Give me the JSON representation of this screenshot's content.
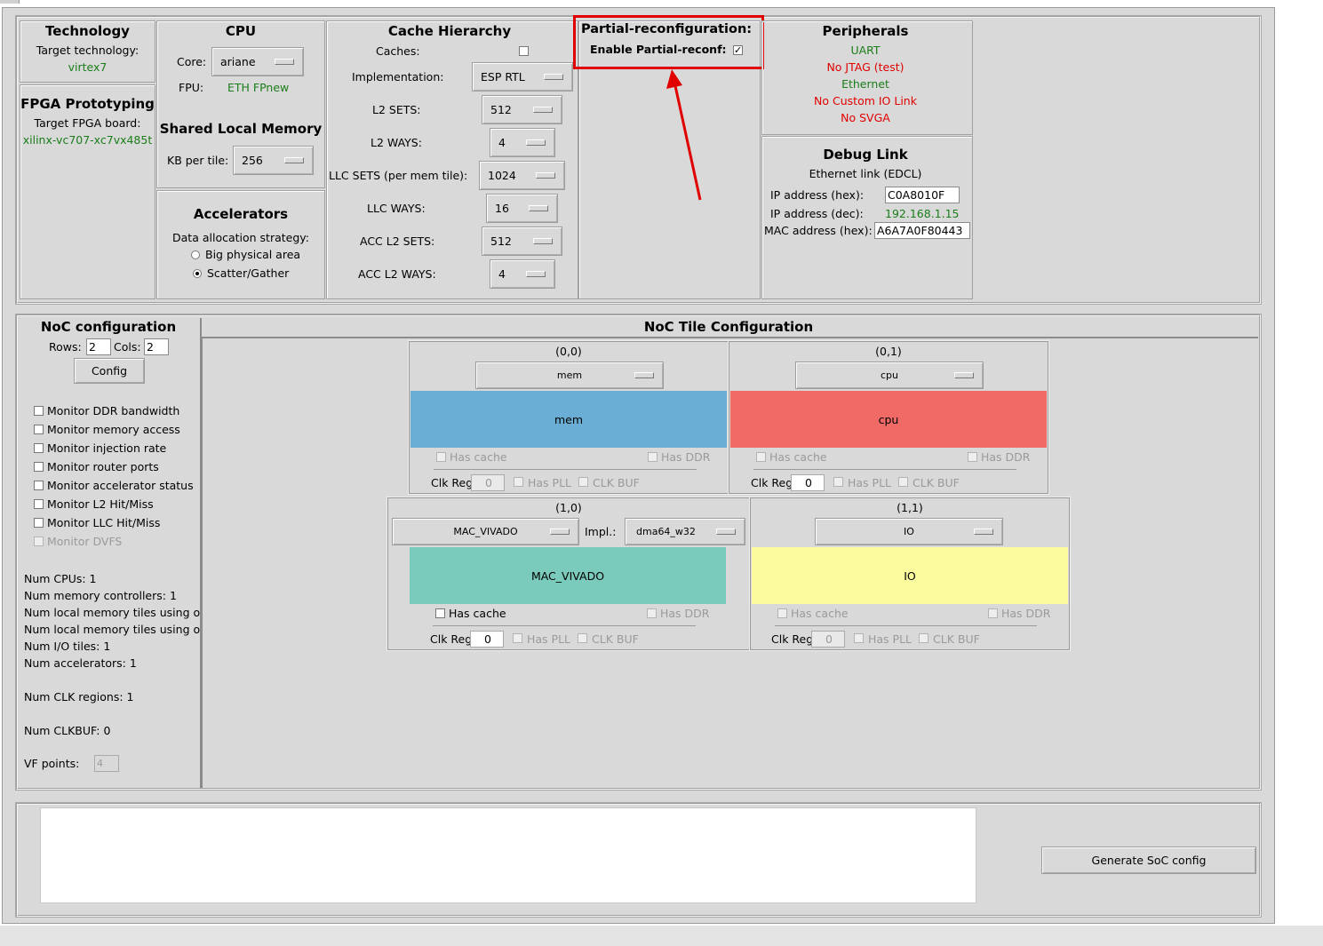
{
  "technology": {
    "title": "Technology",
    "target_label": "Target technology:",
    "target_value": "virtex7"
  },
  "fpga": {
    "title": "FPGA Prototyping",
    "board_label": "Target FPGA board:",
    "board_value": "xilinx-vc707-xc7vx485t"
  },
  "cpu": {
    "title": "CPU",
    "core_label": "Core:",
    "core_value": "ariane",
    "fpu_label": "FPU:",
    "fpu_value": "ETH FPnew"
  },
  "shared_mem": {
    "title": "Shared Local Memory",
    "kb_label": "KB per tile:",
    "kb_value": "256"
  },
  "accelerators": {
    "title": "Accelerators",
    "strategy_label": "Data allocation strategy:",
    "opt1": "Big physical area",
    "opt2": "Scatter/Gather",
    "selected": "Scatter/Gather"
  },
  "cache": {
    "title": "Cache Hierarchy",
    "caches_label": "Caches:",
    "caches_checked": false,
    "impl_label": "Implementation:",
    "impl_value": "ESP RTL",
    "l2_sets_label": "L2 SETS:",
    "l2_sets": "512",
    "l2_ways_label": "L2 WAYS:",
    "l2_ways": "4",
    "llc_sets_label": "LLC SETS (per mem tile):",
    "llc_sets": "1024",
    "llc_ways_label": "LLC WAYS:",
    "llc_ways": "16",
    "acc_l2_sets_label": "ACC L2 SETS:",
    "acc_l2_sets": "512",
    "acc_l2_ways_label": "ACC L2 WAYS:",
    "acc_l2_ways": "4"
  },
  "pr": {
    "title": "Partial-reconfiguration:",
    "enable_label": "Enable Partial-reconf:",
    "enabled": true,
    "check_glyph": "✓"
  },
  "peripherals": {
    "title": "Peripherals",
    "uart": "UART",
    "jtag": "No JTAG (test)",
    "ethernet": "Ethernet",
    "custom_io": "No Custom IO Link",
    "svga": "No SVGA"
  },
  "debug": {
    "title": "Debug Link",
    "subtitle": "Ethernet link (EDCL)",
    "ip_hex_label": "IP address (hex):",
    "ip_hex": "C0A8010F",
    "ip_dec_label": "IP address (dec):",
    "ip_dec": "192.168.1.15",
    "mac_label": "MAC address (hex):",
    "mac": "A6A7A0F80443"
  },
  "noc": {
    "title": "NoC configuration",
    "rows_label": "Rows:",
    "rows": "2",
    "cols_label": "Cols:",
    "cols": "2",
    "config_button": "Config",
    "monitors": [
      {
        "label": "Monitor DDR bandwidth",
        "enabled": true
      },
      {
        "label": "Monitor memory access",
        "enabled": true
      },
      {
        "label": "Monitor injection rate",
        "enabled": true
      },
      {
        "label": "Monitor router ports",
        "enabled": true
      },
      {
        "label": "Monitor accelerator status",
        "enabled": true
      },
      {
        "label": "Monitor L2 Hit/Miss",
        "enabled": true
      },
      {
        "label": "Monitor LLC Hit/Miss",
        "enabled": true
      },
      {
        "label": "Monitor DVFS",
        "enabled": false
      }
    ],
    "stats": {
      "cpus": "Num CPUs: 1",
      "mem_ctrl": "Num memory controllers: 1",
      "local_on": "Num local memory tiles using on",
      "local_off": "Num local memory tiles using off",
      "io": "Num I/O tiles: 1",
      "acc": "Num accelerators: 1",
      "clk_regions": "Num CLK regions: 1",
      "clkbuf": "Num CLKBUF: 0"
    },
    "vf_label": "VF points:",
    "vf_value": "4"
  },
  "tile_config": {
    "title": "NoC Tile Configuration",
    "tiles": [
      {
        "coord": "(0,0)",
        "type": "mem",
        "block": "mem",
        "color": "#6aaed6",
        "has_cache": "Has cache",
        "has_ddr": "Has DDR",
        "clk_reg": "Clk Reg",
        "clk_val": "0",
        "has_pll": "Has PLL",
        "clk_buf": "CLK BUF"
      },
      {
        "coord": "(0,1)",
        "type": "cpu",
        "block": "cpu",
        "color": "#f06a66",
        "has_cache": "Has cache",
        "has_ddr": "Has DDR",
        "clk_reg": "Clk Reg",
        "clk_val": "0",
        "has_pll": "Has PLL",
        "clk_buf": "CLK BUF"
      },
      {
        "coord": "(1,0)",
        "type": "MAC_VIVADO",
        "impl_label": "Impl.:",
        "impl": "dma64_w32",
        "block": "MAC_VIVADO",
        "color": "#7bcbbd",
        "has_cache": "Has cache",
        "has_ddr": "Has DDR",
        "clk_reg": "Clk Reg",
        "clk_val": "0",
        "has_pll": "Has PLL",
        "clk_buf": "CLK BUF"
      },
      {
        "coord": "(1,1)",
        "type": "IO",
        "block": "IO",
        "color": "#fbfb9e",
        "has_cache": "Has cache",
        "has_ddr": "Has DDR",
        "clk_reg": "Clk Reg",
        "clk_val": "0",
        "has_pll": "Has PLL",
        "clk_buf": "CLK BUF"
      }
    ]
  },
  "generate_button": "Generate SoC config",
  "colors": {
    "bg": "#d9d9d9",
    "ok_green": "#1a7d1a",
    "error_red": "#e00000",
    "highlight": "#e10000"
  }
}
